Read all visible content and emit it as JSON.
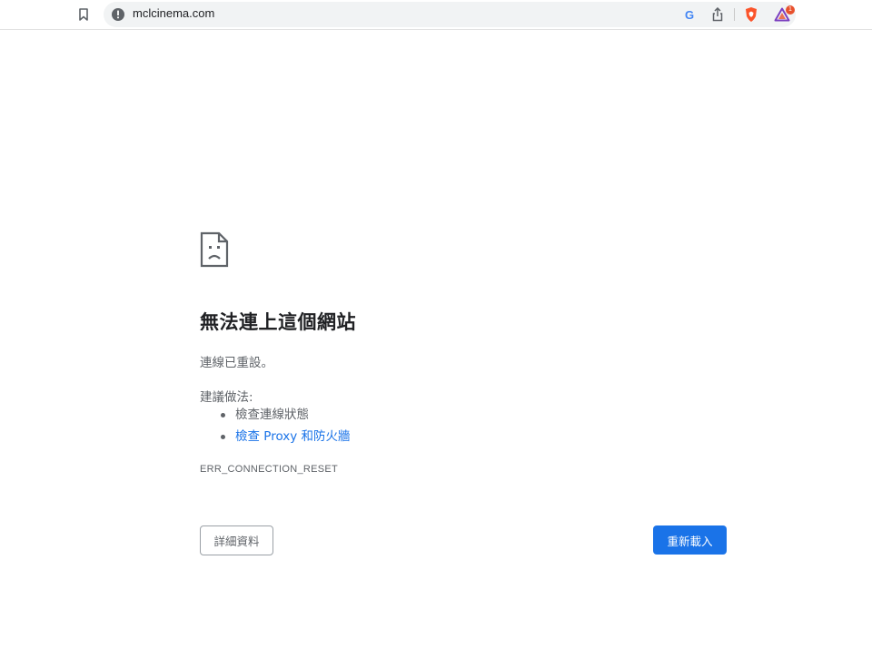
{
  "toolbar": {
    "url": "mclcinema.com",
    "icons": [
      "bookmark-icon",
      "info-icon",
      "google-icon",
      "share-icon",
      "brave-shields-icon",
      "brave-rewards-icon"
    ],
    "google_letter": "G",
    "rewards_badge": "1",
    "accent_colors": {
      "brave": "#fb542b",
      "rewards": "#7b3fbf",
      "badge": "#e8512d"
    }
  },
  "error_page": {
    "icon": "sad-page-icon",
    "heading": "無法連上這個網站",
    "subtitle": "連線已重設。",
    "suggestions_title": "建議做法:",
    "suggestions": [
      {
        "text": "檢查連線狀態",
        "is_link": false
      },
      {
        "text": "檢查 Proxy 和防火牆",
        "is_link": true
      }
    ],
    "error_code": "ERR_CONNECTION_RESET",
    "details_button": "詳細資料",
    "reload_button": "重新載入",
    "colors": {
      "primary": "#1a73e8",
      "text": "#202124",
      "secondary_text": "#5f6368"
    }
  }
}
